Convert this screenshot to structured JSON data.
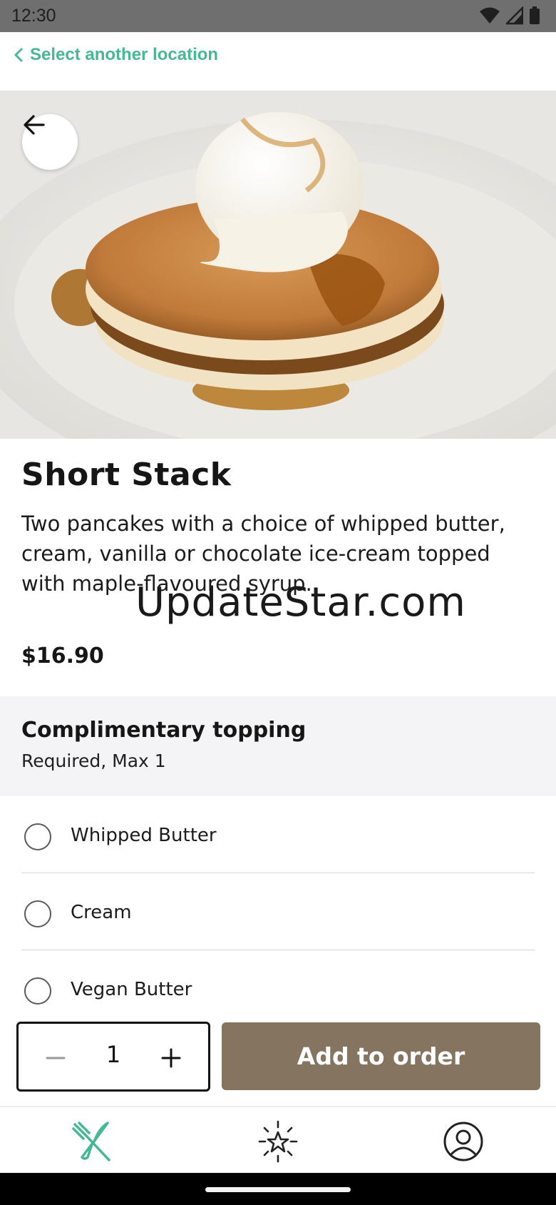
{
  "status_bar": {
    "time": "12:30"
  },
  "nav": {
    "back_label": "Select another location"
  },
  "product": {
    "title": "Short Stack",
    "description": "Two pancakes with a choice of whipped butter, cream, vanilla or chocolate ice-cream topped with maple-flavoured syrup.",
    "price": "$16.90"
  },
  "watermark": "UpdateStar.com",
  "topping_section": {
    "title": "Complimentary topping",
    "subtitle": "Required, Max 1",
    "options": [
      {
        "label": "Whipped Butter",
        "selected": false
      },
      {
        "label": "Cream",
        "selected": false
      },
      {
        "label": "Vegan Butter",
        "selected": false
      }
    ]
  },
  "order_bar": {
    "quantity": "1",
    "add_label": "Add to order"
  },
  "tabs": [
    {
      "icon": "fork-knife-icon",
      "active": true
    },
    {
      "icon": "star-burst-icon",
      "active": false
    },
    {
      "icon": "profile-icon",
      "active": false
    }
  ],
  "colors": {
    "accent_green": "#45b98f",
    "button_brown": "#857560",
    "section_bg": "#f4f4f6"
  }
}
